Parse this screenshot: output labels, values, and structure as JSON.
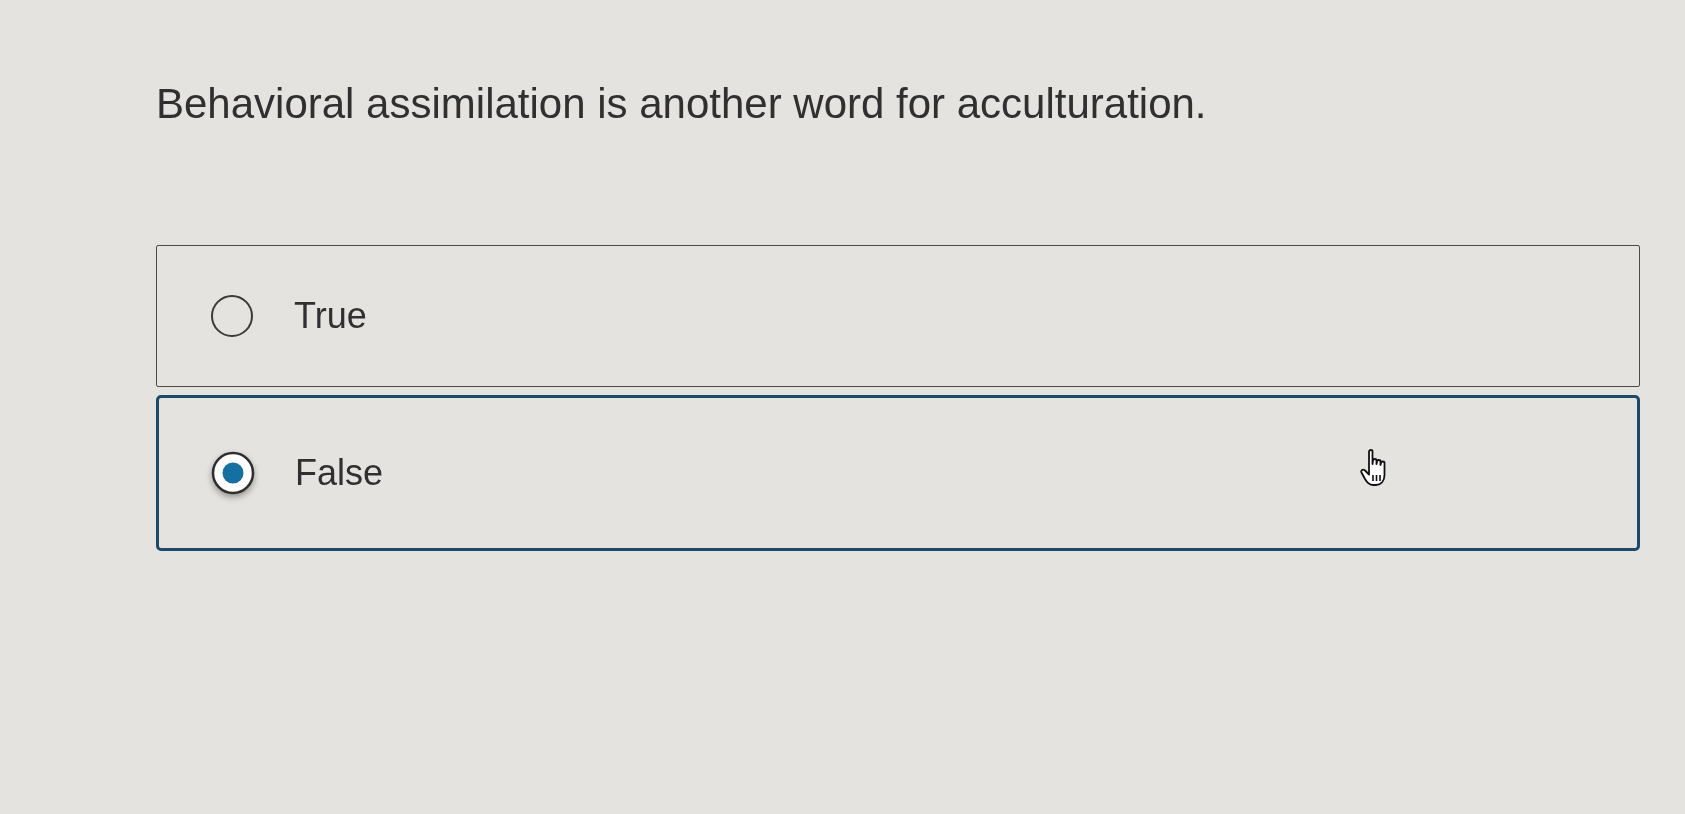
{
  "question": {
    "text": "Behavioral assimilation is another word for acculturation."
  },
  "options": [
    {
      "label": "True",
      "selected": false
    },
    {
      "label": "False",
      "selected": true
    }
  ]
}
